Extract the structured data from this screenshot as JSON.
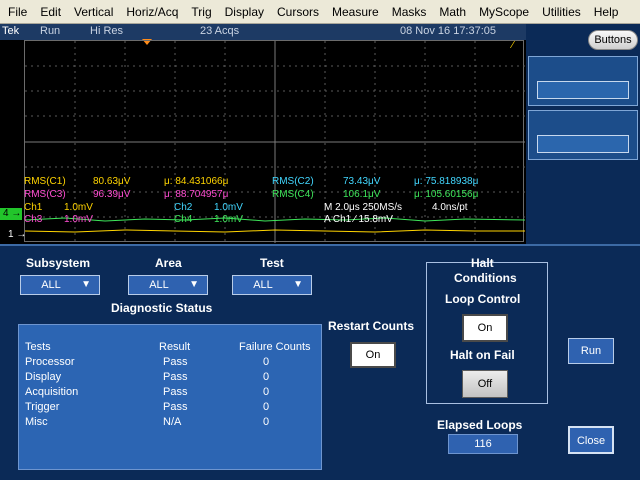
{
  "menu": [
    "File",
    "Edit",
    "Vertical",
    "Horiz/Acq",
    "Trig",
    "Display",
    "Cursors",
    "Measure",
    "Masks",
    "Math",
    "MyScope",
    "Utilities",
    "Help"
  ],
  "status": {
    "brand": "Tek",
    "mode": "Run",
    "acq_mode": "Hi Res",
    "acqs": "23 Acqs",
    "datetime": "08 Nov 16 17:37:05"
  },
  "right_panel": {
    "buttons_label": "Buttons"
  },
  "readouts": {
    "rms_c1": "RMS(C1)",
    "rms_c1_val": "80.63μV",
    "mean_c1": "μ: 84.431066μ",
    "rms_c2": "RMS(C2)",
    "rms_c2_val": "73.43μV",
    "mean_c2": "μ: 75.818938μ",
    "rms_c3": "RMS(C3)",
    "rms_c3_val": "96.39μV",
    "mean_c3": "μ: 88.704957μ",
    "rms_c4": "RMS(C4)",
    "rms_c4_val": "106.1μV",
    "mean_c4": "μ: 105.60156μ",
    "ch1_label": "Ch1",
    "ch1_scale": "1.0mV",
    "ch2_label": "Ch2",
    "ch2_scale": "1.0mV",
    "ch3_label": "Ch3",
    "ch3_scale": "1.0mV",
    "ch4_label": "Ch4",
    "ch4_scale": "1.0mV",
    "timebase": "M 2.0μs 250MS/s",
    "resolution": "4.0ns/pt",
    "trigger": "A  Ch1  ⁄  15.8mV"
  },
  "markers": {
    "ch4": "4 →",
    "ch1": "1 →",
    "edge": "⁄"
  },
  "controls": {
    "subsystem_label": "Subsystem",
    "subsystem_value": "ALL",
    "area_label": "Area",
    "area_value": "ALL",
    "test_label": "Test",
    "test_value": "ALL",
    "diag_title": "Diagnostic Status",
    "restart_label": "Restart Counts",
    "restart_value": "On",
    "halt_title_1": "Halt",
    "halt_title_2": "Conditions",
    "loop_control_label": "Loop Control",
    "loop_control_value": "On",
    "halt_on_fail_label": "Halt on Fail",
    "halt_on_fail_value": "Off",
    "run_label": "Run",
    "elapsed_label": "Elapsed Loops",
    "elapsed_value": "116",
    "close_label": "Close"
  },
  "diagnostics": {
    "headers": [
      "Tests",
      "Result",
      "Failure Counts"
    ],
    "rows": [
      [
        "Processor",
        "Pass",
        "0"
      ],
      [
        "Display",
        "Pass",
        "0"
      ],
      [
        "Acquisition",
        "Pass",
        "0"
      ],
      [
        "Trigger",
        "Pass",
        "0"
      ],
      [
        "Misc",
        "N/A",
        "0"
      ]
    ]
  },
  "colors": {
    "ch1": "#ffd400",
    "ch2": "#42d7ff",
    "ch3": "#ff4dd2",
    "ch4": "#3ee65a",
    "panel_bg": "#0b2a57"
  }
}
